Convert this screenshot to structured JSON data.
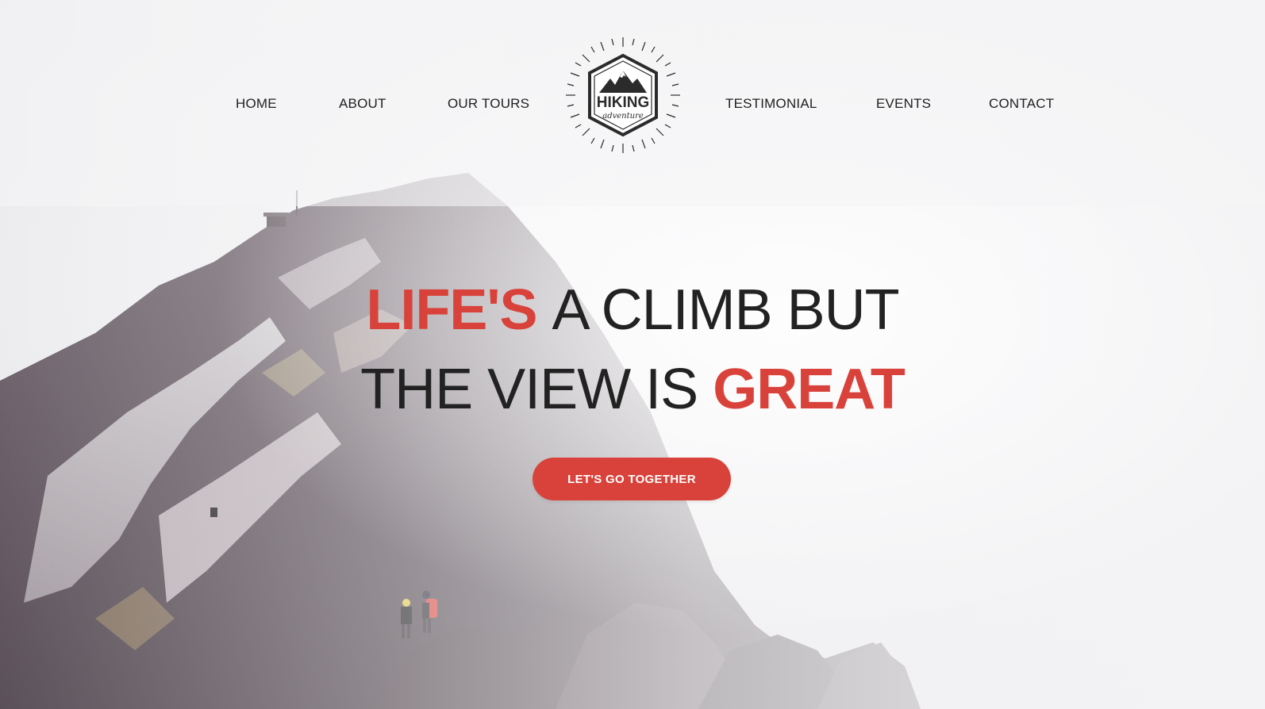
{
  "nav": {
    "items_left": [
      "HOME",
      "ABOUT",
      "OUR TOURS"
    ],
    "items_right": [
      "TESTIMONIAL",
      "EVENTS",
      "CONTACT"
    ]
  },
  "logo": {
    "title": "HIKING",
    "subtitle": "adventure"
  },
  "hero": {
    "line1_accent": "LIFE'S",
    "line1_rest": "A CLIMB BUT",
    "line2_rest": "THE VIEW IS",
    "line2_accent": "GREAT",
    "cta_label": "LET'S GO TOGETHER"
  },
  "colors": {
    "accent": "#d9423a",
    "text": "#1f1f1f",
    "background": "#f1f1f3"
  }
}
